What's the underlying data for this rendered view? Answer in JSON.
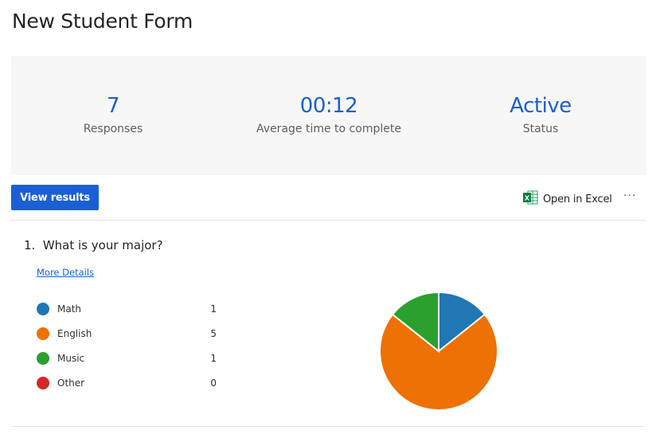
{
  "page": {
    "title": "New Student Form"
  },
  "summary": {
    "stats": [
      {
        "value": "7",
        "label": "Responses"
      },
      {
        "value": "00:12",
        "label": "Average time to complete"
      },
      {
        "value": "Active",
        "label": "Status"
      }
    ]
  },
  "toolbar": {
    "view_results_label": "View results",
    "open_excel_label": "Open in Excel",
    "more_label": "···"
  },
  "question": {
    "number": "1.",
    "text": "What is your major?",
    "title": "1.  What is your major?",
    "more_details_label": "More Details"
  },
  "chart_data": {
    "type": "pie",
    "title": "What is your major?",
    "categories": [
      "Math",
      "English",
      "Music",
      "Other"
    ],
    "values": [
      1,
      5,
      1,
      0
    ],
    "colors": [
      "#1f77b4",
      "#ed7105",
      "#2ca02c",
      "#d62728"
    ],
    "legend_position": "left"
  }
}
